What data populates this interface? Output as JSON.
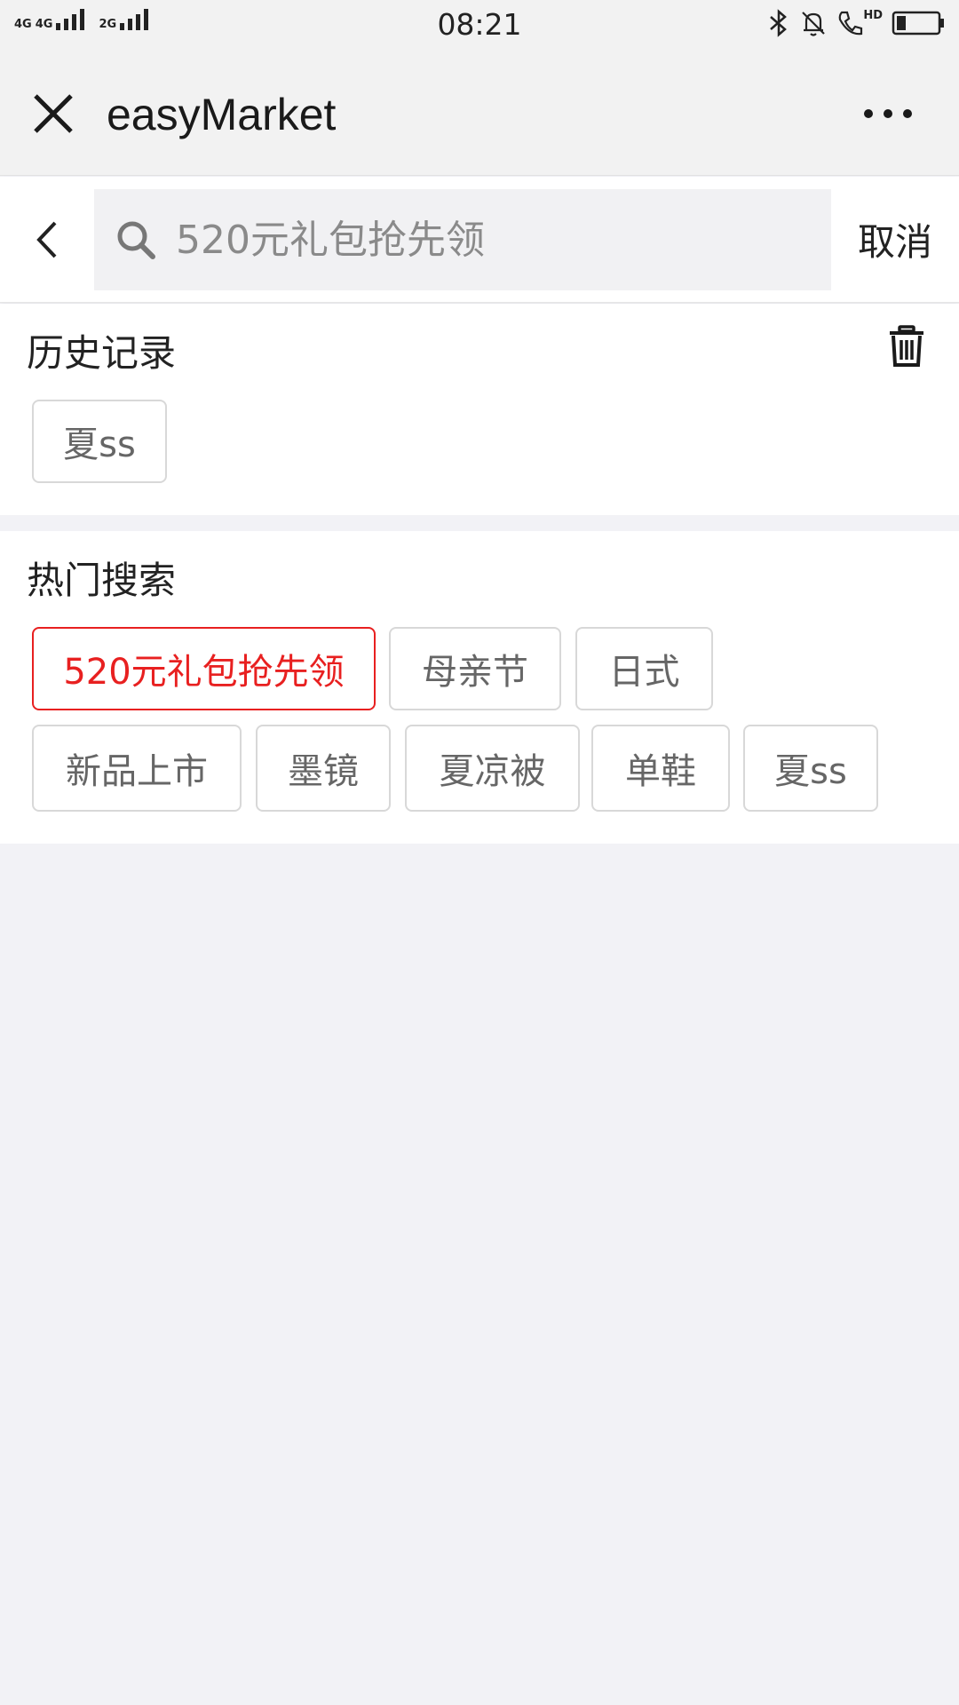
{
  "status_bar": {
    "network_1": "4G",
    "network_2": "4G",
    "network_3": "2G",
    "time": "08:21",
    "hd_label": "HD"
  },
  "title_bar": {
    "title": "easyMarket"
  },
  "search": {
    "placeholder": "520元礼包抢先领",
    "value": "",
    "cancel_label": "取消"
  },
  "history": {
    "title": "历史记录",
    "items": [
      "夏ss"
    ]
  },
  "hot_search": {
    "title": "热门搜索",
    "items": [
      "520元礼包抢先领",
      "母亲节",
      "日式",
      "新品上市",
      "墨镜",
      "夏凉被",
      "单鞋",
      "夏ss"
    ]
  },
  "colors": {
    "accent": "#e82020",
    "background": "#f2f2f6"
  },
  "icons": [
    "close-icon",
    "more-icon",
    "back-icon",
    "search-icon",
    "trash-icon",
    "bluetooth-icon",
    "bell-mute-icon",
    "phone-hd-icon",
    "battery-icon"
  ]
}
